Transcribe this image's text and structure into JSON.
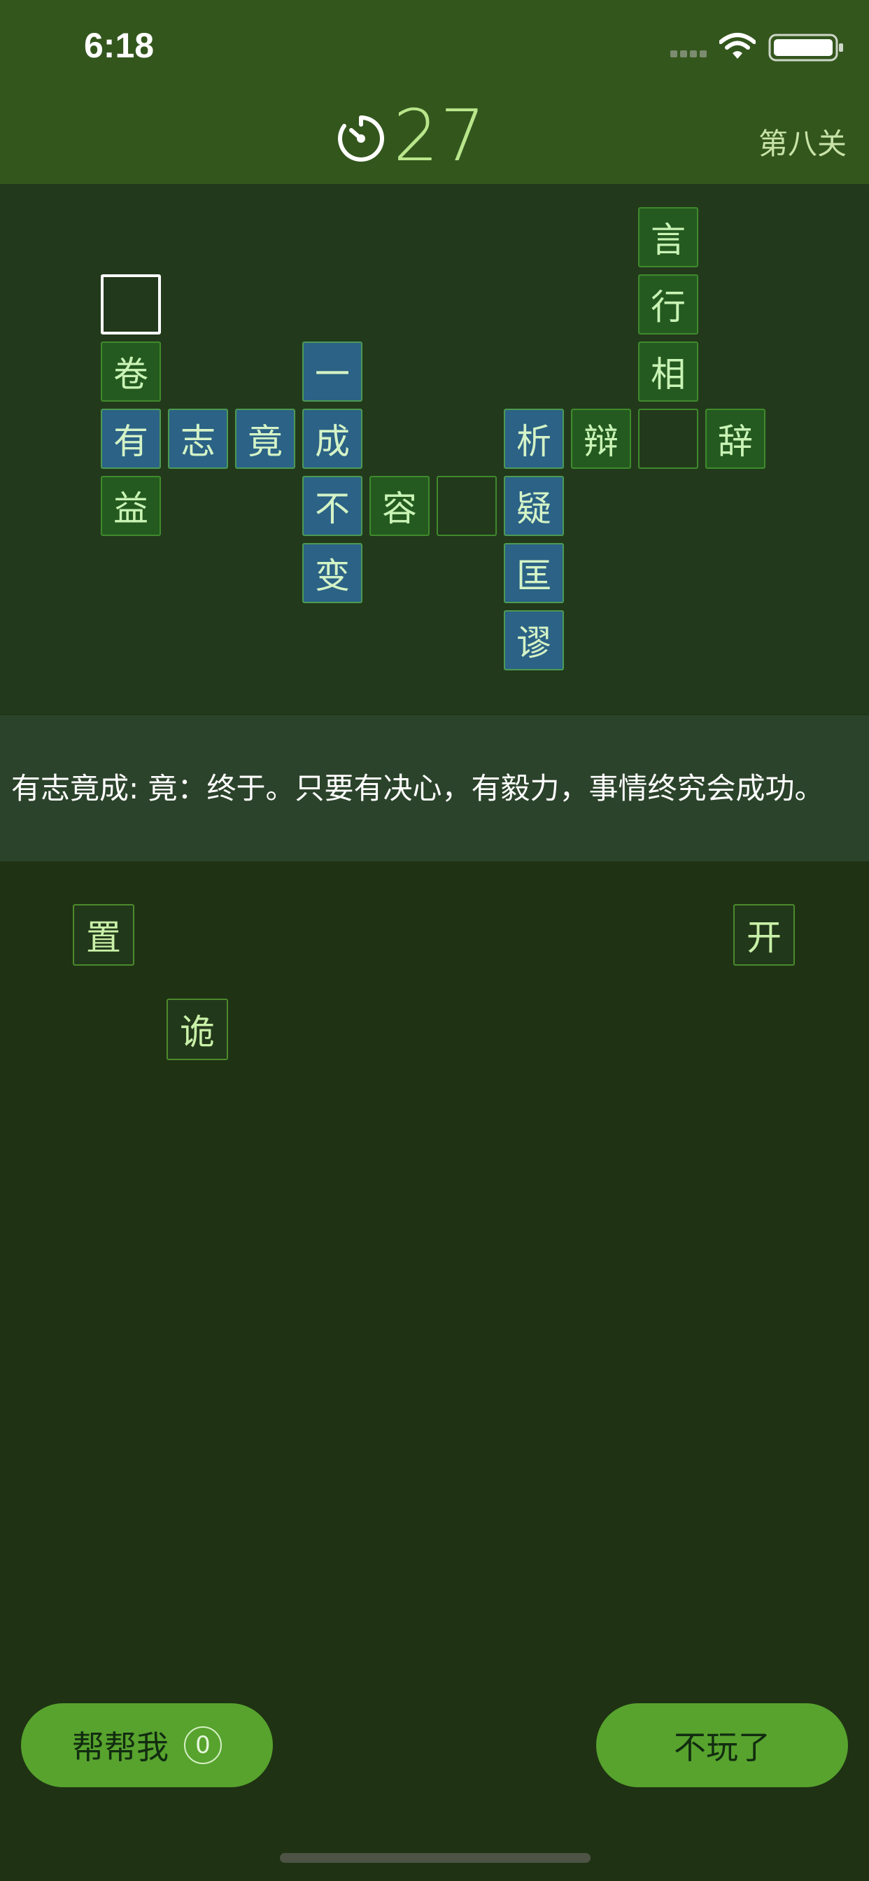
{
  "status_bar": {
    "time": "6:18"
  },
  "header": {
    "timer": "27",
    "level": "第八关"
  },
  "board": {
    "cells": [
      {
        "ch": "言",
        "state": "fixed"
      },
      {
        "ch": "",
        "state": "active"
      },
      {
        "ch": "行",
        "state": "fixed"
      },
      {
        "ch": "卷",
        "state": "fixed"
      },
      {
        "ch": "一",
        "state": "done"
      },
      {
        "ch": "相",
        "state": "fixed"
      },
      {
        "ch": "有",
        "state": "done"
      },
      {
        "ch": "志",
        "state": "done"
      },
      {
        "ch": "竟",
        "state": "done"
      },
      {
        "ch": "成",
        "state": "done"
      },
      {
        "ch": "析",
        "state": "done"
      },
      {
        "ch": "辩",
        "state": "fixed"
      },
      {
        "ch": "",
        "state": "empty"
      },
      {
        "ch": "辞",
        "state": "fixed"
      },
      {
        "ch": "益",
        "state": "fixed"
      },
      {
        "ch": "不",
        "state": "done"
      },
      {
        "ch": "容",
        "state": "fixed"
      },
      {
        "ch": "",
        "state": "empty"
      },
      {
        "ch": "疑",
        "state": "done"
      },
      {
        "ch": "变",
        "state": "done"
      },
      {
        "ch": "匡",
        "state": "done"
      },
      {
        "ch": "谬",
        "state": "done"
      }
    ]
  },
  "hint": "有志竟成: 竟：终于。只要有决心，有毅力，事情终究会成功。",
  "tiles": [
    "置",
    "开",
    "诡"
  ],
  "buttons": {
    "help_label": "帮帮我",
    "help_count": "0",
    "quit_label": "不玩了"
  },
  "colors": {
    "header_bg": "#33561d",
    "board_bg": "#22391b",
    "button_green": "#57a32e",
    "done_cell": "#2b6285",
    "timer_text": "#b9e68b"
  }
}
